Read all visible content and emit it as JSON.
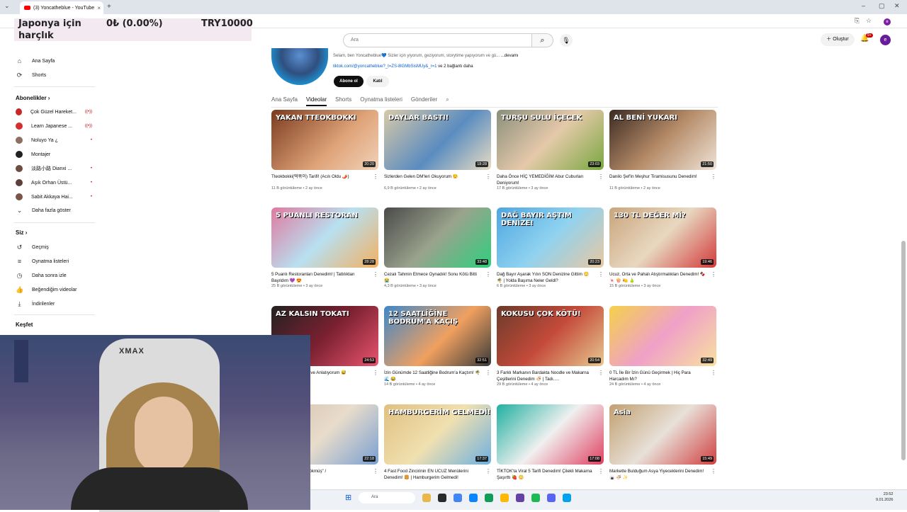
{
  "browser": {
    "tab_title": "(3) Yoncatheblue - YouTube",
    "tab_close": "×",
    "new_tab": "+",
    "tab_menu": "⌄",
    "win_min": "–",
    "win_max": "▢",
    "win_close": "✕"
  },
  "banner": {
    "line1": "Japonya için",
    "line2": "harçlık",
    "amount": "0₺ (0.00%)",
    "goal": "TRY10000"
  },
  "sidebar": {
    "home": "Ana Sayfa",
    "shorts": "Shorts",
    "subscriptions_heading": "Abonelikler",
    "subscriptions": [
      {
        "name": "Çok Güzel Hareket...",
        "color": "#c62828",
        "badge": "((•))"
      },
      {
        "name": "Learn Japanese ...",
        "color": "#d32f2f",
        "badge": "((•))"
      },
      {
        "name": "Noluyo Ya ¿",
        "color": "#8d6e63",
        "badge": "•"
      },
      {
        "name": "Montajer",
        "color": "#212121",
        "badge": ""
      },
      {
        "name": "淡路小路 Dianxi ...",
        "color": "#6d4c41",
        "badge": "•"
      },
      {
        "name": "Aşık Orhan Üstü...",
        "color": "#5d4037",
        "badge": "•"
      },
      {
        "name": "Sabit Akkaya Hai...",
        "color": "#795548",
        "badge": "•"
      }
    ],
    "show_more": "Daha fazla göster",
    "you_heading": "Siz",
    "history": "Geçmiş",
    "playlists": "Oynatma listeleri",
    "watch_later": "Daha sonra izle",
    "liked": "Beğendiğim videolar",
    "downloads": "İndirilenler",
    "explore": "Keşfet"
  },
  "header": {
    "search_placeholder": "Ara",
    "create": "Oluştur",
    "notifications": "9+",
    "user_initial": "e"
  },
  "channel": {
    "description": "Selam, ben Yoncatheblue💙 Sizler için yiyorum, geziyorum, storytime yapıyorum ve gü...",
    "more": "...devamı",
    "link": "tiktok.com/@yoncatheblue?_t=ZS-8lGMbSisMUy&_r=1",
    "link_more": "ve 2 bağlantı daha",
    "subscribe": "Abone ol",
    "join": "Katıl",
    "tabs": [
      "Ana Sayfa",
      "Videolar",
      "Shorts",
      "Oynatma listeleri",
      "Gönderiler"
    ]
  },
  "videos": [
    {
      "title": "Tteokbokki(떡볶이) Tarifi! (Acılı Oldu 🌶️)",
      "meta": "11 B görüntüleme • 2 ay önce",
      "duration": "20:20",
      "overlay": "YAKAN TTEOKBOKKI",
      "bg": "linear-gradient(135deg,#7a3b1e,#e0a47a 60,#f1d2b8)"
    },
    {
      "title": "Sizlerden Gelen DM'leri Okuyorum 😌",
      "meta": "6,9 B görüntüleme • 2 ay önce",
      "duration": "18:28",
      "overlay": "DAYLAR BASTI!",
      "bg": "linear-gradient(135deg,#d9c9a8,#5a8cc0 55%,#e8dcc4)"
    },
    {
      "title": "Daha Önce HİÇ YEMEDİĞİM Abur Cuburları Deniyorum!",
      "meta": "17 B görüntüleme • 3 ay önce",
      "duration": "23:03",
      "overlay": "TURŞU SULU İÇECEK",
      "bg": "linear-gradient(135deg,#8a8f7c,#e5c9a9 50%,#79a840)"
    },
    {
      "title": "Danilo Şef'in Meşhur Tiramisusunu Denedim!",
      "meta": "11 B görüntüleme • 2 ay önce",
      "duration": "21:50",
      "overlay": "AL BENİ YUKARI",
      "bg": "linear-gradient(135deg,#3b2a22,#b48a67 50%,#efe3d6)"
    },
    {
      "title": "5 Puanlı Restoranları Denedim! | Tatlılıktan Bayıldım 💜 😍",
      "meta": "25 B görüntüleme • 3 ay önce",
      "duration": "28:28",
      "overlay": "5 PUANLI RESTORAN",
      "bg": "linear-gradient(135deg,#e07aa0,#b8e0f0 50%,#f3b062)"
    },
    {
      "title": "Cezalı Tahmin Etmece Oynadık! Sonu Kötü Bitti 😭",
      "meta": "4,3 B görüntüleme • 3 ay önce",
      "duration": "33:48",
      "overlay": "",
      "bg": "linear-gradient(135deg,#4a4a4a,#9aa38c 50%,#2ecf7d)"
    },
    {
      "title": "Dağ Bayır Aşarak Yılın SON Denizine Gittim 😳 🌴 | Yolda Başıma Neler Geldi?",
      "meta": "6 B görüntüleme • 3 ay önce",
      "duration": "20:23",
      "overlay": "DAĞ BAYIR AŞTIM DENİZE!",
      "bg": "linear-gradient(135deg,#4ea6e0,#8fd2f0 50%,#e9c8a2)"
    },
    {
      "title": "Ucuz, Orta ve Pahalı Atıştırmalıkları Denedim! 🍫 🍬 🍿 🍋 🍐",
      "meta": "15 B görüntüleme • 3 ay önce",
      "duration": "19:46",
      "overlay": "130 TL DEĞER Mİ?",
      "bg": "linear-gradient(135deg,#c9a57c,#e8d8c0 50%,#d23a3a)"
    },
    {
      "title": "...yum İlginç, Komik ve Anlatıyorum 😅",
      "meta": "",
      "duration": "24:53",
      "overlay": "AZ KALSIN TOKATI",
      "bg": "linear-gradient(135deg,#222,#7a2030 50%,#e9546f)"
    },
    {
      "title": "İzin Günümde 12 Saatliğine Bodrum'a Kaçtım! 🌴 🌊 😂",
      "meta": "14 B görüntüleme • 4 ay önce",
      "duration": "32:51",
      "overlay": "12 SAATLİĞİNE BODRUM'A KAÇIŞ",
      "bg": "linear-gradient(135deg,#3f87c8,#f0a060 55%,#3a3a3a)"
    },
    {
      "title": "3 Farklı Markanın Bardakta Noodle ve Makarna Çeşitlerini Denedim 🍜 | Tadı.....",
      "meta": "29 B görüntüleme • 4 ay önce",
      "duration": "20:54",
      "overlay": "KOKUSU ÇOK KÖTÜ!",
      "bg": "linear-gradient(135deg,#6a3b2a,#c44a3a 50%,#e8c890)"
    },
    {
      "title": "0 TL İle Bir İzin Günü Geçirmek | Hiç Para Harcadım Mı?",
      "meta": "24 B görüntüleme • 4 ay önce",
      "duration": "32:49",
      "overlay": "",
      "bg": "linear-gradient(135deg,#f4d24a,#f0a0c8 50%,#f8e0a0)"
    },
    {
      "title": "...yorum | \"Yüzün Çökmüş\" /",
      "meta": "",
      "duration": "22:18",
      "overlay": "",
      "bg": "linear-gradient(135deg,#d4c0a8,#e8dccc 50%,#7aa0d0)"
    },
    {
      "title": "4 Fast Food Zincirinin EN UCUZ Menülerini Denedim! 🍔 | Hamburgerim Gelmedi!",
      "meta": "",
      "duration": "17:37",
      "overlay": "HAMBURGERİM GELMEDİ!",
      "bg": "linear-gradient(135deg,#e0c080,#f0e0b0 50%,#6fb0e0)"
    },
    {
      "title": "TİKTOK'ta Viral 5 Tarifi Denedim! Çilekli Makarna Şaşırttı 🍓 😳",
      "meta": "",
      "duration": "17:08",
      "overlay": "",
      "bg": "linear-gradient(135deg,#20b0a0,#f0f0f0 50%,#e04060)"
    },
    {
      "title": "Markette Bulduğum Asya Yiyeceklerini Denedim! 🍙 🍜 ✨",
      "meta": "",
      "duration": "15:49",
      "overlay": "Asia",
      "bg": "linear-gradient(135deg,#c0a070,#e8e0d8 50%,#d04040)"
    }
  ],
  "webcam": {
    "chair_brand": "XMAX"
  },
  "taskbar": {
    "search": "Ara",
    "time": "23:52",
    "date": "9.01.2026"
  }
}
